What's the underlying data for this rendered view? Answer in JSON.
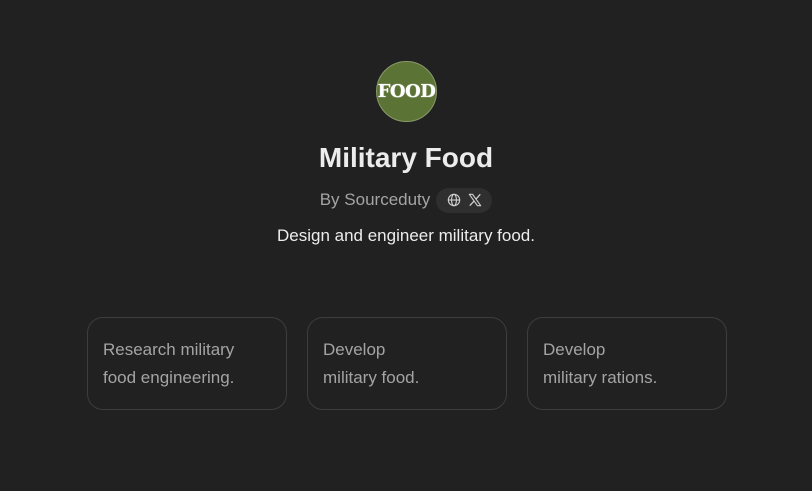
{
  "gpt": {
    "logo_text": "FOOD",
    "name": "Military Food",
    "byline": "By Sourceduty",
    "description": "Design and engineer military food."
  },
  "social": {
    "icons": [
      "globe-icon",
      "x-logo-icon"
    ]
  },
  "starters": [
    {
      "text": "Research military\nfood engineering."
    },
    {
      "text": "Develop\nmilitary food."
    },
    {
      "text": "Develop\nmilitary rations."
    }
  ],
  "colors": {
    "background": "#212121",
    "logo_background": "#5b7334",
    "card_border": "#3d3d3d",
    "muted_text": "#a4a4a4",
    "primary_text": "#ececec"
  }
}
